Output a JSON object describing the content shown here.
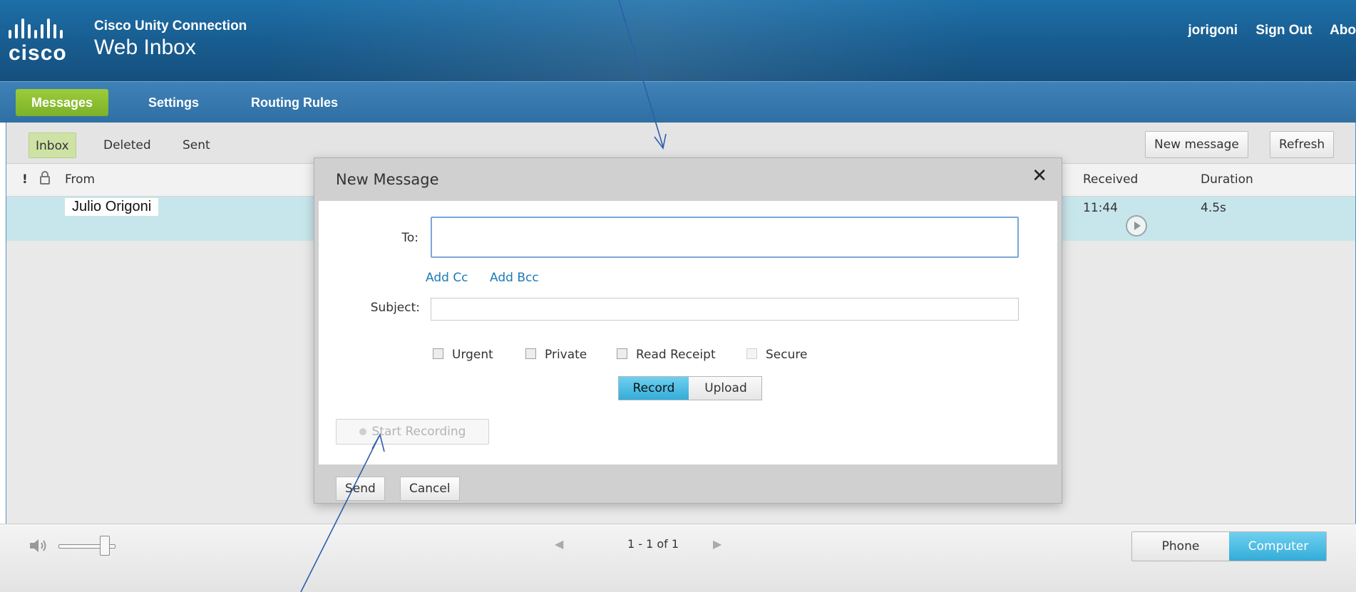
{
  "brand": {
    "logo_text": "cisco",
    "product": "Cisco Unity Connection",
    "app_title": "Web Inbox"
  },
  "header_links": {
    "user": "jorigoni",
    "sign_out": "Sign Out",
    "about": "Abo"
  },
  "nav": {
    "items": [
      {
        "label": "Messages"
      },
      {
        "label": "Settings"
      },
      {
        "label": "Routing Rules"
      }
    ]
  },
  "folders": [
    {
      "label": "Inbox"
    },
    {
      "label": "Deleted"
    },
    {
      "label": "Sent"
    }
  ],
  "toolbar": {
    "new_message": "New message",
    "refresh": "Refresh"
  },
  "columns": {
    "urgent": "!",
    "from": "From",
    "received": "Received",
    "duration": "Duration"
  },
  "messages": [
    {
      "from": "Julio Origoni",
      "received": "11:44",
      "duration": "4.5s"
    }
  ],
  "footer": {
    "pager": "1 - 1 of 1",
    "prev": "◀",
    "next": "▶",
    "phone": "Phone",
    "computer": "Computer"
  },
  "dialog": {
    "title": "New Message",
    "close": "✕",
    "to_label": "To:",
    "to_value": "",
    "add_cc": "Add Cc",
    "add_bcc": "Add Bcc",
    "subject_label": "Subject:",
    "subject_value": "",
    "options": [
      "Urgent",
      "Private",
      "Read Receipt",
      "Secure"
    ],
    "record": "Record",
    "upload": "Upload",
    "start_recording": "Start Recording",
    "send": "Send",
    "cancel": "Cancel"
  },
  "colors": {
    "header": "#195f93",
    "nav": "#3478ad",
    "active_green": "#8cc034",
    "row_highlight": "#c7e6ec",
    "accent_blue": "#33acd8",
    "link": "#1d7ab8"
  }
}
